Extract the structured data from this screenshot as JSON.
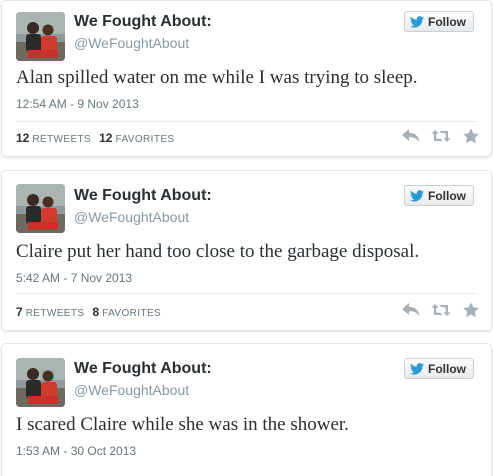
{
  "colors": {
    "name": "#292f33",
    "muted": "#8899a6",
    "icon": "#a5b0b8",
    "bird": "#2b9bd8"
  },
  "tweets": [
    {
      "display_name": "We Fought About:",
      "handle": "@WeFoughtAbout",
      "follow_label": "Follow",
      "text": "Alan spilled water on me while I was trying to sleep.",
      "timestamp": "12:54 AM - 9 Nov 2013",
      "retweets": "12",
      "retweets_label": "RETWEETS",
      "favorites": "12",
      "favorites_label": "FAVORITES",
      "icons": [
        "reply-icon",
        "retweet-icon",
        "favorite-icon"
      ]
    },
    {
      "display_name": "We Fought About:",
      "handle": "@WeFoughtAbout",
      "follow_label": "Follow",
      "text": "Claire put her hand too close to the garbage disposal.",
      "timestamp": "5:42 AM - 7 Nov 2013",
      "retweets": "7",
      "retweets_label": "RETWEETS",
      "favorites": "8",
      "favorites_label": "FAVORITES",
      "icons": [
        "reply-icon",
        "retweet-icon",
        "favorite-icon"
      ]
    },
    {
      "display_name": "We Fought About:",
      "handle": "@WeFoughtAbout",
      "follow_label": "Follow",
      "text": "I scared Claire while she was in the shower.",
      "timestamp": "1:53 AM - 30 Oct 2013"
    }
  ]
}
